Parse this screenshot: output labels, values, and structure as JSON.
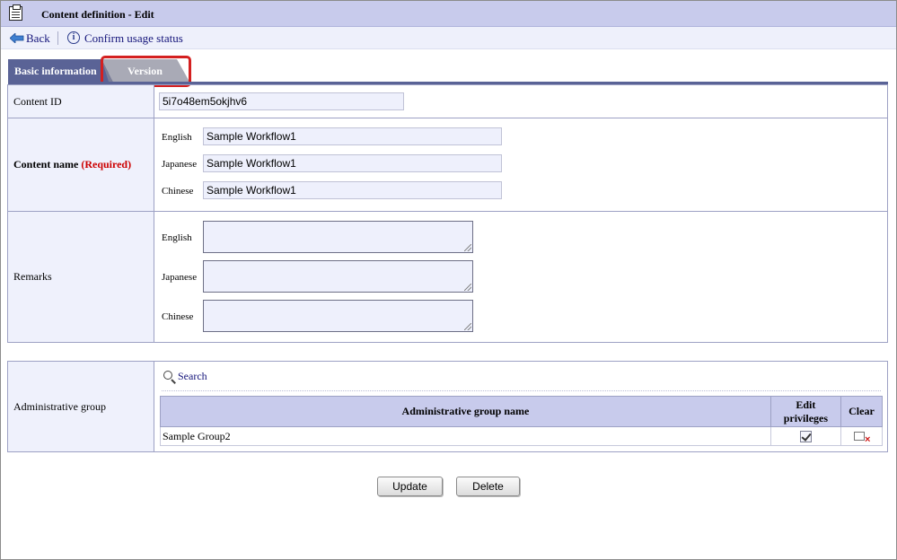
{
  "header": {
    "title": "Content definition - Edit"
  },
  "actions": {
    "back_label": "Back",
    "confirm_label": "Confirm usage status"
  },
  "tabs": [
    {
      "label": "Basic information",
      "active": true
    },
    {
      "label": "Version",
      "active": false
    }
  ],
  "form": {
    "content_id": {
      "label": "Content ID",
      "value": "5i7o48em5okjhv6"
    },
    "content_name": {
      "label": "Content name",
      "required_label": "(Required)",
      "fields": [
        {
          "lang": "English",
          "value": "Sample Workflow1"
        },
        {
          "lang": "Japanese",
          "value": "Sample Workflow1"
        },
        {
          "lang": "Chinese",
          "value": "Sample Workflow1"
        }
      ]
    },
    "remarks": {
      "label": "Remarks",
      "fields": [
        {
          "lang": "English",
          "value": ""
        },
        {
          "lang": "Japanese",
          "value": ""
        },
        {
          "lang": "Chinese",
          "value": ""
        }
      ]
    }
  },
  "admin_group": {
    "label": "Administrative group",
    "search_label": "Search",
    "columns": [
      "Administrative group name",
      "Edit privileges",
      "Clear"
    ],
    "rows": [
      {
        "name": "Sample Group2",
        "edit_privileges": true
      }
    ]
  },
  "buttons": {
    "update": "Update",
    "delete": "Delete"
  },
  "colors": {
    "header_bg": "#c8cbec",
    "tab_active": "#5a6396",
    "highlight": "#d42020",
    "required": "#cc0000"
  }
}
